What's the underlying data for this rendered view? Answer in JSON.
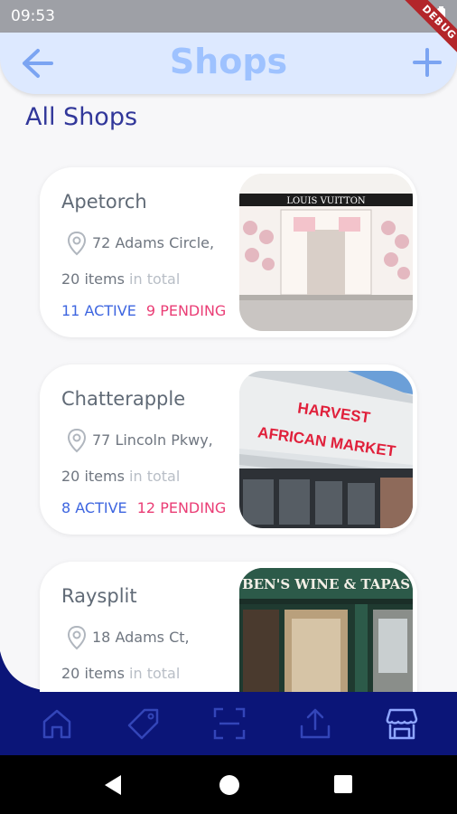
{
  "status_bar": {
    "time": "09:53",
    "debug_label": "DEBUG"
  },
  "app_bar": {
    "title": "Shops",
    "back_icon": "arrow-left-icon",
    "add_icon": "plus-icon"
  },
  "section": {
    "title": "All Shops"
  },
  "shops": [
    {
      "name": "Apetorch",
      "address": "72 Adams Circle,",
      "items_count": "20 items",
      "items_suffix": " in total",
      "active": "11 ACTIVE",
      "pending": "9 PENDING",
      "image_sign": "LOUIS VUITTON"
    },
    {
      "name": "Chatterapple",
      "address": "77 Lincoln Pkwy,",
      "items_count": "20 items",
      "items_suffix": " in total",
      "active": "8 ACTIVE",
      "pending": "12 PENDING",
      "image_sign_line1": "HARVEST",
      "image_sign_line2": "AFRICAN MARKET"
    },
    {
      "name": "Raysplit",
      "address": "18 Adams Ct,",
      "items_count": "20 items",
      "items_suffix": " in total",
      "image_sign": "BEN'S WINE & TAPAS"
    }
  ],
  "bottom_nav": {
    "items": [
      {
        "icon": "home-icon"
      },
      {
        "icon": "tag-icon"
      },
      {
        "icon": "scan-icon"
      },
      {
        "icon": "upload-icon"
      },
      {
        "icon": "store-icon"
      }
    ]
  },
  "colors": {
    "app_bar_bg": "#dde9ff",
    "title": "#9ec2ff",
    "section_title": "#31379a",
    "active": "#3e66e0",
    "pending": "#ea3d75",
    "nav_bg": "#0b1578",
    "nav_icon": "#3345b8",
    "nav_icon_selected": "#8fa6ff"
  }
}
